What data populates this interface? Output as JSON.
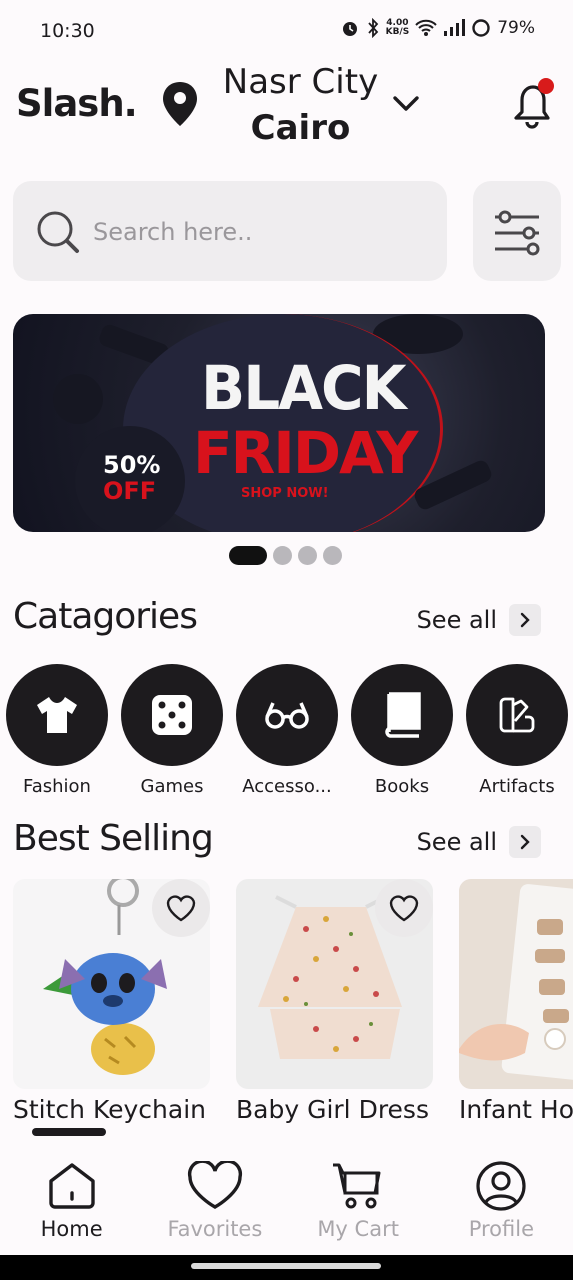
{
  "status_bar": {
    "time": "10:30",
    "speed": "4.00",
    "speed_unit": "KB/S",
    "battery": "79%"
  },
  "header": {
    "logo": "Slash.",
    "area": "Nasr City",
    "city": "Cairo"
  },
  "search": {
    "placeholder": "Search here.."
  },
  "banner": {
    "line1": "BLACK",
    "line2": "FRIDAY",
    "cta": "SHOP NOW!",
    "discount": "50%",
    "discount_suffix": "OFF",
    "slides": 4,
    "active_slide": 1
  },
  "categories": {
    "title": "Catagories",
    "see_all": "See all",
    "items": [
      {
        "label": "Fashion",
        "icon": "tshirt-icon"
      },
      {
        "label": "Games",
        "icon": "dice-icon"
      },
      {
        "label": "Accesso...",
        "icon": "glasses-icon"
      },
      {
        "label": "Books",
        "icon": "book-icon"
      },
      {
        "label": "Artifacts",
        "icon": "art-icon"
      }
    ]
  },
  "best_selling": {
    "title": "Best Selling",
    "see_all": "See all",
    "items": [
      {
        "name": "Stitch Keychain"
      },
      {
        "name": "Baby Girl Dress"
      },
      {
        "name": "Infant Ho"
      }
    ]
  },
  "bottom_nav": {
    "items": [
      {
        "label": "Home",
        "active": true
      },
      {
        "label": "Favorites",
        "active": false
      },
      {
        "label": "My Cart",
        "active": false
      },
      {
        "label": "Profile",
        "active": false
      }
    ]
  },
  "colors": {
    "notification_dot": "#d81b1b",
    "banner_red": "#d8121c",
    "dark": "#1d1b1e"
  }
}
